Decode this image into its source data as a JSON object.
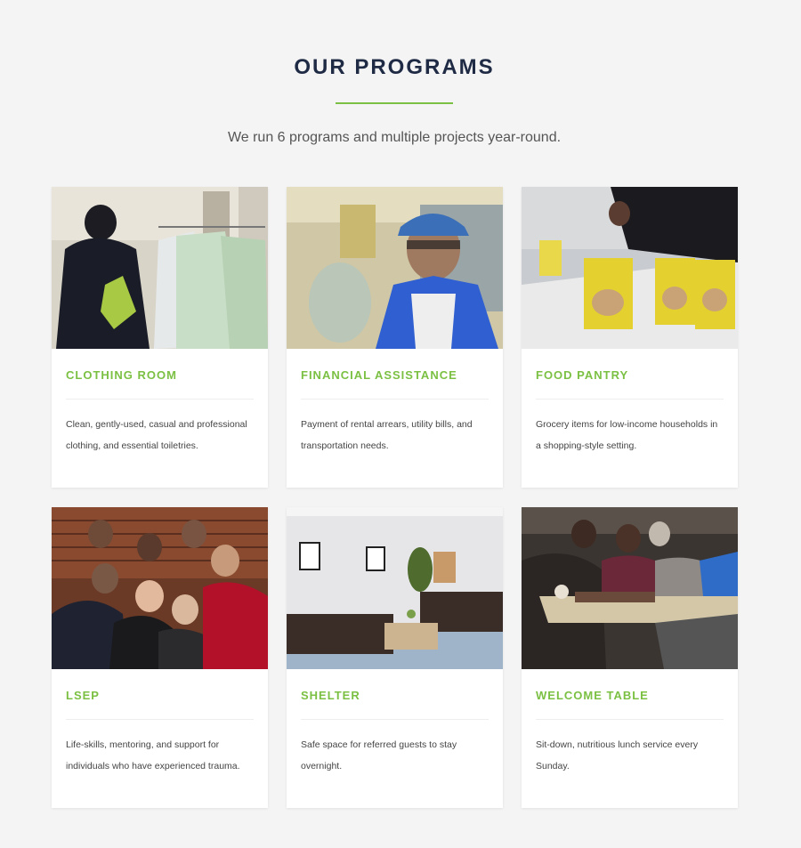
{
  "section": {
    "title": "OUR PROGRAMS",
    "subtitle": "We run 6 programs and multiple projects year-round."
  },
  "colors": {
    "accent": "#7bc043",
    "heading": "#1f2a44",
    "background": "#f4f4f4"
  },
  "programs": [
    {
      "title": "CLOTHING ROOM",
      "description": "Clean, gently-used, casual and professional clothing, and essential toiletries."
    },
    {
      "title": "FINANCIAL ASSISTANCE",
      "description": "Payment of rental arrears, utility bills, and transportation needs."
    },
    {
      "title": "FOOD PANTRY",
      "description": "Grocery items for low-income households in a shopping-style setting."
    },
    {
      "title": "LSEP",
      "description": "Life-skills, mentoring, and support for individuals who have experienced trauma."
    },
    {
      "title": "SHELTER",
      "description": "Safe space for referred guests to stay overnight."
    },
    {
      "title": "WELCOME TABLE",
      "description": "Sit-down, nutritious lunch service every Sunday."
    }
  ]
}
